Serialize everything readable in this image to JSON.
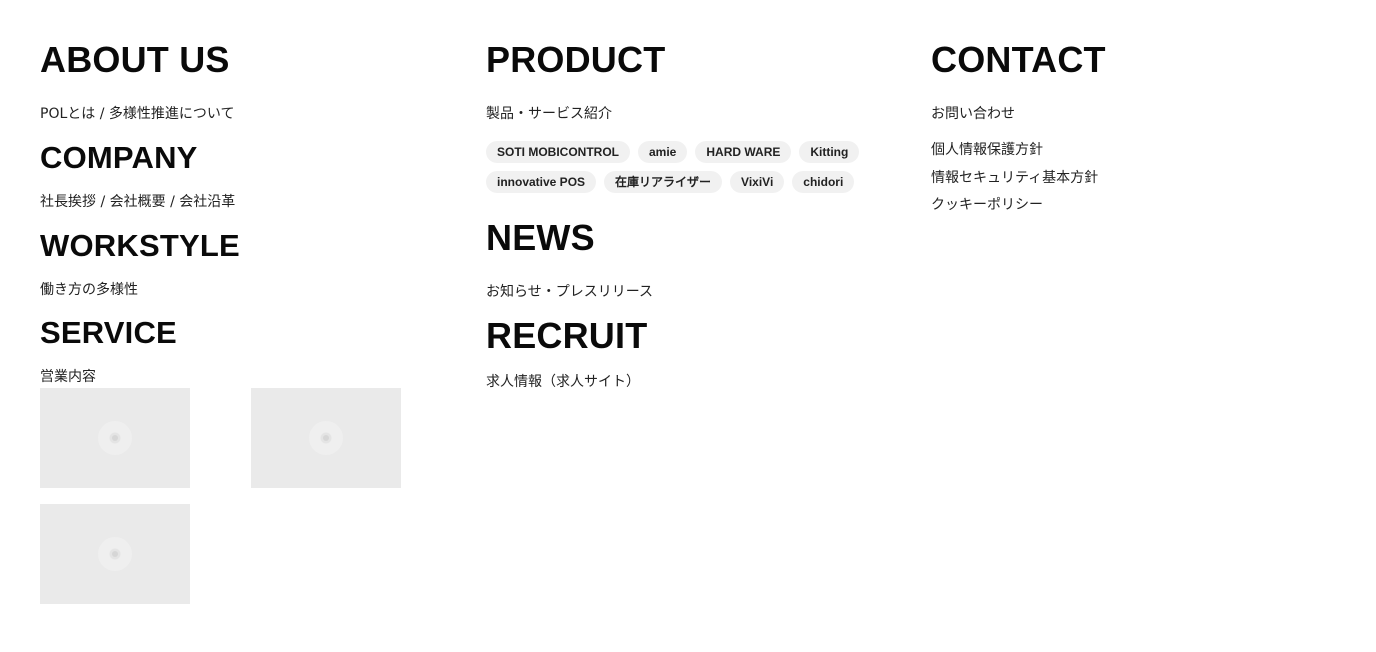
{
  "about": {
    "heading": "ABOUT US",
    "link": "POLとは / 多様性推進について"
  },
  "company": {
    "heading": "COMPANY",
    "link": "社長挨拶 / 会社概要 / 会社沿革"
  },
  "workstyle": {
    "heading": "WORKSTYLE",
    "link": "働き方の多様性"
  },
  "service": {
    "heading": "SERVICE",
    "link": "営業内容"
  },
  "product": {
    "heading": "PRODUCT",
    "link": "製品・サービス紹介",
    "tags": [
      "SOTI MOBICONTROL",
      "amie",
      "HARD WARE",
      "Kitting",
      "innovative POS",
      "在庫リアライザー",
      "VixiVi",
      "chidori"
    ]
  },
  "news": {
    "heading": "NEWS",
    "link": "お知らせ・プレスリリース"
  },
  "recruit": {
    "heading": "RECRUIT",
    "link": "求人情報（求人サイト）"
  },
  "contact": {
    "heading": "CONTACT",
    "links": [
      "お問い合わせ",
      "個人情報保護方針",
      "情報セキュリティ基本方針",
      "クッキーポリシー"
    ]
  },
  "thumbnails": [
    {
      "icon": "loading-spinner-icon"
    },
    {
      "icon": "loading-spinner-icon"
    },
    {
      "icon": "loading-spinner-icon"
    }
  ]
}
